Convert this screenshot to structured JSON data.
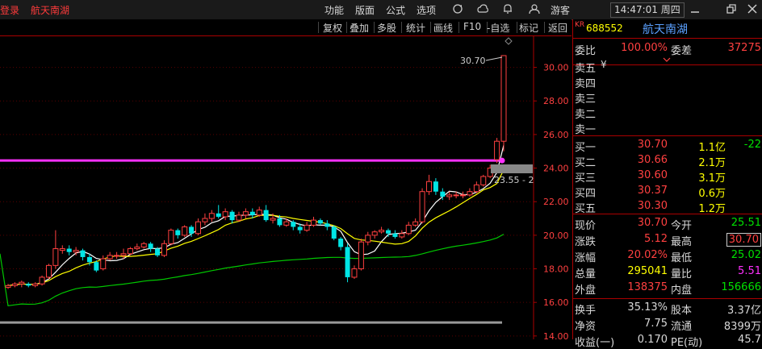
{
  "topbar": {
    "title_prefix": "登录",
    "stock_name": "航天南湖",
    "menu": [
      "功能",
      "版面",
      "公式",
      "选项"
    ],
    "user": "游客",
    "clock": "14:47:01 周四"
  },
  "toolbar": [
    "复权",
    "叠加",
    "多股",
    "统计",
    "画线",
    "F10",
    "-自选",
    "标记",
    "返回"
  ],
  "panel": {
    "kr": "KR",
    "code": "688552",
    "name": "航天南湖",
    "weibi_label": "委比",
    "weibi_value": "100.00%",
    "weicha_label": "委差",
    "weicha_value": "37275",
    "sell": [
      {
        "label": "卖五",
        "price": "",
        "vol": ""
      },
      {
        "label": "卖四",
        "price": "",
        "vol": ""
      },
      {
        "label": "卖三",
        "price": "",
        "vol": ""
      },
      {
        "label": "卖二",
        "price": "",
        "vol": ""
      },
      {
        "label": "卖一",
        "price": "",
        "vol": ""
      }
    ],
    "currency_mark": "¥",
    "buy": [
      {
        "label": "买一",
        "price": "30.70",
        "vol": "1.1亿",
        "chg": "-22"
      },
      {
        "label": "买二",
        "price": "30.66",
        "vol": "2.1万",
        "chg": ""
      },
      {
        "label": "买三",
        "price": "30.60",
        "vol": "3.1万",
        "chg": ""
      },
      {
        "label": "买四",
        "price": "30.37",
        "vol": "0.6万",
        "chg": ""
      },
      {
        "label": "买五",
        "price": "30.30",
        "vol": "1.2万",
        "chg": ""
      }
    ],
    "stats": [
      {
        "l1": "现价",
        "v1": "30.70",
        "l2": "今开",
        "v2": "25.51"
      },
      {
        "l1": "涨跌",
        "v1": "5.12",
        "l2": "最高",
        "v2": "30.70"
      },
      {
        "l1": "涨幅",
        "v1": "20.02%",
        "l2": "最低",
        "v2": "25.02"
      },
      {
        "l1": "总量",
        "v1": "295041",
        "l2": "量比",
        "v2": "5.51"
      },
      {
        "l1": "外盘",
        "v1": "138375",
        "l2": "内盘",
        "v2": "156666"
      }
    ],
    "stats2": [
      {
        "l1": "换手",
        "v1": "35.13%",
        "l2": "股本",
        "v2": "3.37亿"
      },
      {
        "l1": "净资",
        "v1": "7.75",
        "l2": "流通",
        "v2": "8399万"
      },
      {
        "l1": "收益(一)",
        "v1": "0.170",
        "l2": "PE(动)",
        "v2": "45.7"
      }
    ],
    "colors": {
      "up": "#ff4040",
      "down": "#00e000",
      "neutral": "#d8d8d8",
      "yellow": "#ffff00",
      "magenta": "#ff30ff"
    }
  },
  "chart_data": {
    "type": "candlestick",
    "y_ticks": [
      "30.00",
      "28.00",
      "26.00",
      "24.00",
      "22.00",
      "20.00",
      "18.00",
      "16.00",
      "14.00"
    ],
    "ylim": [
      13.8,
      31.9
    ],
    "annotations": {
      "high_label": "30.70",
      "price_tag": "23.55 - 2"
    },
    "reference_lines": [
      {
        "color": "#ff30ff",
        "value": 24.45
      },
      {
        "color": "#999999",
        "value": 14.8
      }
    ],
    "candles": [
      [
        16.9,
        17.0,
        16.8,
        17.1
      ],
      [
        17.0,
        17.1,
        16.9,
        17.2
      ],
      [
        17.1,
        17.2,
        16.9,
        17.3
      ],
      [
        17.1,
        17.0,
        16.9,
        17.2
      ],
      [
        17.0,
        17.1,
        16.9,
        17.2
      ],
      [
        17.1,
        17.5,
        17.0,
        17.6
      ],
      [
        17.5,
        18.2,
        17.4,
        18.3
      ],
      [
        18.2,
        19.2,
        18.0,
        20.3
      ],
      [
        19.1,
        19.2,
        18.9,
        19.4
      ],
      [
        19.2,
        19.0,
        18.8,
        19.4
      ],
      [
        19.0,
        19.1,
        18.8,
        19.3
      ],
      [
        19.1,
        18.7,
        18.5,
        19.2
      ],
      [
        18.7,
        18.4,
        18.2,
        18.9
      ],
      [
        18.4,
        17.9,
        17.8,
        18.5
      ],
      [
        18.0,
        18.6,
        17.9,
        18.8
      ],
      [
        18.6,
        18.8,
        18.5,
        19.0
      ],
      [
        18.8,
        18.8,
        18.6,
        19.0
      ],
      [
        18.8,
        18.9,
        18.6,
        19.2
      ],
      [
        18.9,
        19.2,
        18.8,
        19.3
      ],
      [
        19.2,
        19.3,
        19.1,
        19.5
      ],
      [
        19.3,
        19.5,
        19.2,
        19.6
      ],
      [
        19.5,
        19.2,
        19.0,
        19.6
      ],
      [
        19.2,
        18.8,
        18.7,
        19.3
      ],
      [
        18.8,
        19.5,
        18.7,
        19.7
      ],
      [
        19.5,
        20.3,
        19.4,
        20.4
      ],
      [
        20.3,
        20.0,
        19.8,
        20.4
      ],
      [
        20.0,
        20.5,
        19.9,
        20.6
      ],
      [
        20.5,
        20.1,
        19.9,
        20.6
      ],
      [
        20.1,
        20.8,
        20.0,
        21.0
      ],
      [
        20.8,
        21.0,
        20.6,
        21.3
      ],
      [
        21.0,
        21.3,
        20.8,
        21.5
      ],
      [
        21.3,
        21.1,
        21.0,
        21.8
      ],
      [
        21.1,
        21.4,
        20.9,
        21.6
      ],
      [
        21.4,
        20.9,
        20.7,
        21.5
      ],
      [
        20.9,
        21.2,
        20.8,
        21.4
      ],
      [
        21.2,
        21.4,
        21.0,
        21.6
      ],
      [
        21.4,
        21.2,
        21.0,
        21.6
      ],
      [
        21.2,
        21.5,
        21.1,
        21.7
      ],
      [
        21.5,
        20.9,
        20.8,
        21.8
      ],
      [
        20.9,
        21.0,
        20.7,
        21.3
      ],
      [
        21.0,
        20.6,
        20.5,
        21.2
      ],
      [
        20.6,
        20.8,
        20.5,
        21.0
      ],
      [
        20.8,
        20.5,
        20.3,
        20.9
      ],
      [
        20.5,
        20.3,
        20.1,
        20.7
      ],
      [
        20.3,
        20.6,
        20.2,
        20.8
      ],
      [
        20.6,
        20.9,
        20.5,
        21.1
      ],
      [
        20.9,
        20.7,
        20.6,
        21.0
      ],
      [
        20.7,
        20.5,
        20.3,
        20.9
      ],
      [
        20.5,
        19.8,
        19.7,
        20.6
      ],
      [
        19.8,
        19.3,
        19.1,
        19.9
      ],
      [
        19.3,
        17.5,
        17.2,
        19.5
      ],
      [
        17.5,
        18.0,
        17.4,
        18.2
      ],
      [
        18.0,
        19.6,
        17.9,
        19.8
      ],
      [
        19.6,
        20.0,
        19.4,
        20.2
      ],
      [
        20.0,
        20.2,
        19.8,
        20.3
      ],
      [
        20.2,
        20.3,
        20.1,
        20.5
      ],
      [
        20.3,
        20.1,
        19.9,
        20.4
      ],
      [
        20.1,
        19.9,
        19.8,
        20.3
      ],
      [
        19.9,
        20.1,
        19.8,
        20.3
      ],
      [
        20.1,
        20.6,
        20.0,
        20.8
      ],
      [
        20.6,
        20.8,
        20.5,
        21.0
      ],
      [
        20.8,
        22.6,
        20.7,
        22.8
      ],
      [
        22.6,
        23.2,
        22.4,
        23.6
      ],
      [
        23.2,
        22.6,
        22.4,
        23.4
      ],
      [
        22.6,
        22.3,
        22.1,
        22.8
      ],
      [
        22.3,
        22.4,
        22.1,
        22.6
      ],
      [
        22.4,
        22.4,
        22.2,
        22.6
      ],
      [
        22.4,
        22.4,
        22.2,
        22.6
      ],
      [
        22.4,
        22.6,
        22.3,
        22.8
      ],
      [
        22.6,
        23.0,
        22.5,
        23.2
      ],
      [
        23.0,
        23.5,
        22.9,
        23.6
      ],
      [
        23.5,
        24.0,
        23.4,
        24.2
      ],
      [
        24.5,
        25.6,
        24.3,
        25.8
      ],
      [
        25.6,
        30.7,
        25.0,
        30.7
      ]
    ]
  }
}
